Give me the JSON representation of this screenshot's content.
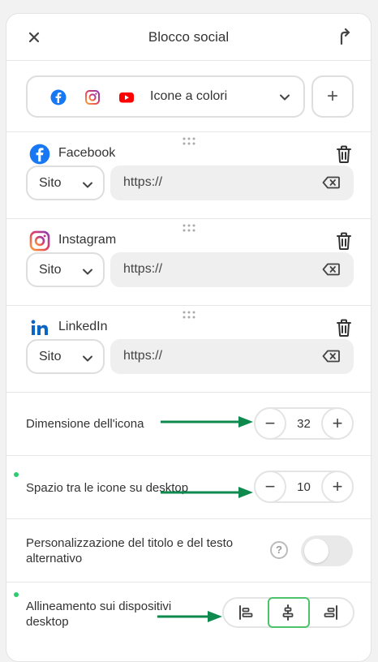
{
  "header": {
    "title": "Blocco social"
  },
  "style_selector": {
    "value": "Icone a colori",
    "add_label": "+"
  },
  "socials": [
    {
      "name": "Facebook",
      "type": "Sito",
      "url": "https://"
    },
    {
      "name": "Instagram",
      "type": "Sito",
      "url": "https://"
    },
    {
      "name": "LinkedIn",
      "type": "Sito",
      "url": "https://"
    }
  ],
  "icon_size": {
    "label": "Dimensione dell'icona",
    "value": "32",
    "minus": "−",
    "plus": "+"
  },
  "icon_spacing": {
    "label": "Spazio tra le icone su desktop",
    "value": "10",
    "minus": "−",
    "plus": "+"
  },
  "title_alt": {
    "label": "Personalizzazione del titolo e del testo alternativo",
    "help": "?",
    "enabled": false
  },
  "alignment": {
    "label": "Allineamento sui dispositivi desktop",
    "selected": "center"
  },
  "colors": {
    "facebook": "#1877f2",
    "instagram": "#e4405f",
    "youtube": "#ff0000",
    "linkedin": "#0a66c2",
    "arrow": "#0e8a4f",
    "active": "#4cc36a"
  }
}
